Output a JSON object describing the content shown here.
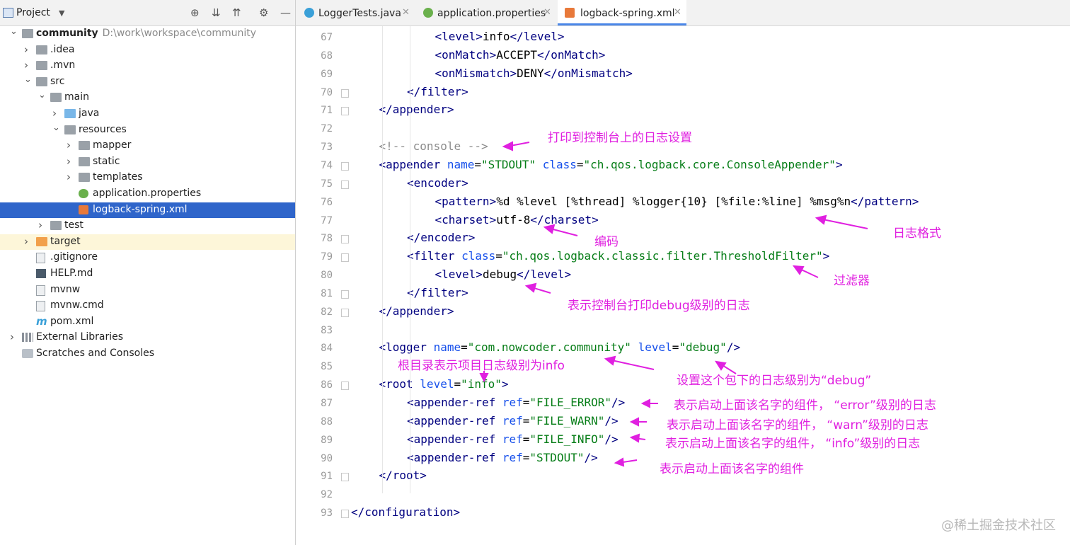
{
  "project_panel": {
    "title": "Project",
    "tree": [
      {
        "label": "community",
        "path": "D:\\work\\workspace\\community",
        "depth": 0,
        "expanded": true,
        "icon": "module-folder-icon",
        "bold": true
      },
      {
        "label": ".idea",
        "depth": 1,
        "expanded": false,
        "icon": "folder-icon"
      },
      {
        "label": ".mvn",
        "depth": 1,
        "expanded": false,
        "icon": "folder-icon"
      },
      {
        "label": "src",
        "depth": 1,
        "expanded": true,
        "icon": "folder-icon"
      },
      {
        "label": "main",
        "depth": 2,
        "expanded": true,
        "icon": "folder-icon"
      },
      {
        "label": "java",
        "depth": 3,
        "expanded": false,
        "icon": "source-folder-icon"
      },
      {
        "label": "resources",
        "depth": 3,
        "expanded": true,
        "icon": "resources-folder-icon"
      },
      {
        "label": "mapper",
        "depth": 4,
        "expanded": false,
        "icon": "folder-icon"
      },
      {
        "label": "static",
        "depth": 4,
        "expanded": false,
        "icon": "folder-icon"
      },
      {
        "label": "templates",
        "depth": 4,
        "expanded": false,
        "icon": "folder-icon"
      },
      {
        "label": "application.properties",
        "depth": 4,
        "icon": "properties-file-icon"
      },
      {
        "label": "logback-spring.xml",
        "depth": 4,
        "icon": "xml-file-icon",
        "selected": true
      },
      {
        "label": "test",
        "depth": 2,
        "expanded": false,
        "icon": "folder-icon"
      },
      {
        "label": "target",
        "depth": 1,
        "expanded": false,
        "icon": "excluded-folder-icon",
        "highlight": true
      },
      {
        "label": ".gitignore",
        "depth": 1,
        "icon": "text-file-icon"
      },
      {
        "label": "HELP.md",
        "depth": 1,
        "icon": "markdown-file-icon"
      },
      {
        "label": "mvnw",
        "depth": 1,
        "icon": "script-file-icon"
      },
      {
        "label": "mvnw.cmd",
        "depth": 1,
        "icon": "text-file-icon"
      },
      {
        "label": "pom.xml",
        "depth": 1,
        "icon": "maven-file-icon"
      },
      {
        "label": "External Libraries",
        "depth": 0,
        "expanded": false,
        "icon": "libraries-icon"
      },
      {
        "label": "Scratches and Consoles",
        "depth": 0,
        "icon": "scratches-icon"
      }
    ]
  },
  "tabs": [
    {
      "label": "LoggerTests.java",
      "icon": "java-class-icon",
      "active": false
    },
    {
      "label": "application.properties",
      "icon": "properties-file-icon",
      "active": false
    },
    {
      "label": "logback-spring.xml",
      "icon": "xml-file-icon",
      "active": true
    }
  ],
  "editor": {
    "lines": [
      {
        "n": "67",
        "indent": 3,
        "tokens": [
          [
            "tg",
            "<level>"
          ],
          [
            "tx",
            "info"
          ],
          [
            "tg",
            "</level>"
          ]
        ]
      },
      {
        "n": "68",
        "indent": 3,
        "tokens": [
          [
            "tg",
            "<onMatch>"
          ],
          [
            "tx",
            "ACCEPT"
          ],
          [
            "tg",
            "</onMatch>"
          ]
        ]
      },
      {
        "n": "69",
        "indent": 3,
        "tokens": [
          [
            "tg",
            "<onMismatch>"
          ],
          [
            "tx",
            "DENY"
          ],
          [
            "tg",
            "</onMismatch>"
          ]
        ]
      },
      {
        "n": "70",
        "indent": 2,
        "tokens": [
          [
            "tg",
            "</filter>"
          ]
        ],
        "fold": true
      },
      {
        "n": "71",
        "indent": 1,
        "tokens": [
          [
            "tg",
            "</appender>"
          ]
        ],
        "fold": true
      },
      {
        "n": "72",
        "indent": 0,
        "tokens": []
      },
      {
        "n": "73",
        "indent": 1,
        "tokens": [
          [
            "cm",
            "<!-- console -->"
          ]
        ]
      },
      {
        "n": "74",
        "indent": 1,
        "tokens": [
          [
            "tg",
            "<appender "
          ],
          [
            "an",
            "name"
          ],
          [
            "tx",
            "="
          ],
          [
            "av",
            "\"STDOUT\""
          ],
          [
            "tx",
            " "
          ],
          [
            "an",
            "class"
          ],
          [
            "tx",
            "="
          ],
          [
            "av",
            "\"ch.qos.logback.core.ConsoleAppender\""
          ],
          [
            "tg",
            ">"
          ]
        ],
        "fold": true
      },
      {
        "n": "75",
        "indent": 2,
        "tokens": [
          [
            "tg",
            "<encoder>"
          ]
        ],
        "fold": true
      },
      {
        "n": "76",
        "indent": 3,
        "tokens": [
          [
            "tg",
            "<pattern>"
          ],
          [
            "tx",
            "%d %level [%thread] %logger{10} [%file:%line] %msg%n"
          ],
          [
            "tg",
            "</pattern>"
          ]
        ]
      },
      {
        "n": "77",
        "indent": 3,
        "tokens": [
          [
            "tg",
            "<charset>"
          ],
          [
            "tx",
            "utf-8"
          ],
          [
            "tg",
            "</charset>"
          ]
        ]
      },
      {
        "n": "78",
        "indent": 2,
        "tokens": [
          [
            "tg",
            "</encoder>"
          ]
        ],
        "fold": true
      },
      {
        "n": "79",
        "indent": 2,
        "tokens": [
          [
            "tg",
            "<filter "
          ],
          [
            "an",
            "class"
          ],
          [
            "tx",
            "="
          ],
          [
            "av",
            "\"ch.qos.logback.classic.filter.ThresholdFilter\""
          ],
          [
            "tg",
            ">"
          ]
        ],
        "fold": true
      },
      {
        "n": "80",
        "indent": 3,
        "tokens": [
          [
            "tg",
            "<level>"
          ],
          [
            "tx",
            "debug"
          ],
          [
            "tg",
            "</level>"
          ]
        ]
      },
      {
        "n": "81",
        "indent": 2,
        "tokens": [
          [
            "tg",
            "</filter>"
          ]
        ],
        "fold": true
      },
      {
        "n": "82",
        "indent": 1,
        "tokens": [
          [
            "tg",
            "</appender>"
          ]
        ],
        "fold": true
      },
      {
        "n": "83",
        "indent": 0,
        "tokens": []
      },
      {
        "n": "84",
        "indent": 1,
        "tokens": [
          [
            "tg",
            "<logger "
          ],
          [
            "an",
            "name"
          ],
          [
            "tx",
            "="
          ],
          [
            "av",
            "\"com.nowcoder.community\""
          ],
          [
            "tx",
            " "
          ],
          [
            "an",
            "level"
          ],
          [
            "tx",
            "="
          ],
          [
            "av",
            "\"debug\""
          ],
          [
            "tg",
            "/>"
          ]
        ]
      },
      {
        "n": "85",
        "indent": 0,
        "tokens": []
      },
      {
        "n": "86",
        "indent": 1,
        "tokens": [
          [
            "tg",
            "<root "
          ],
          [
            "an",
            "level"
          ],
          [
            "tx",
            "="
          ],
          [
            "av",
            "\"info\""
          ],
          [
            "tg",
            ">"
          ]
        ],
        "fold": true
      },
      {
        "n": "87",
        "indent": 2,
        "tokens": [
          [
            "tg",
            "<appender-ref "
          ],
          [
            "an",
            "ref"
          ],
          [
            "tx",
            "="
          ],
          [
            "av",
            "\"FILE_ERROR\""
          ],
          [
            "tg",
            "/>"
          ]
        ]
      },
      {
        "n": "88",
        "indent": 2,
        "tokens": [
          [
            "tg",
            "<appender-ref "
          ],
          [
            "an",
            "ref"
          ],
          [
            "tx",
            "="
          ],
          [
            "av",
            "\"FILE_WARN\""
          ],
          [
            "tg",
            "/>"
          ]
        ]
      },
      {
        "n": "89",
        "indent": 2,
        "tokens": [
          [
            "tg",
            "<appender-ref "
          ],
          [
            "an",
            "ref"
          ],
          [
            "tx",
            "="
          ],
          [
            "av",
            "\"FILE_INFO\""
          ],
          [
            "tg",
            "/>"
          ]
        ]
      },
      {
        "n": "90",
        "indent": 2,
        "tokens": [
          [
            "tg",
            "<appender-ref "
          ],
          [
            "an",
            "ref"
          ],
          [
            "tx",
            "="
          ],
          [
            "av",
            "\"STDOUT\""
          ],
          [
            "tg",
            "/>"
          ]
        ]
      },
      {
        "n": "91",
        "indent": 1,
        "tokens": [
          [
            "tg",
            "</root>"
          ]
        ],
        "fold": true
      },
      {
        "n": "92",
        "indent": 0,
        "tokens": []
      },
      {
        "n": "93",
        "indent": 0,
        "tokens": [
          [
            "tg",
            "</configuration>"
          ]
        ],
        "fold": true
      }
    ]
  },
  "annotations": {
    "console_setting": "打印到控制台上的日志设置",
    "encoding": "编码",
    "log_format": "日志格式",
    "filter": "过滤器",
    "console_debug": "表示控制台打印debug级别的日志",
    "root_info": "根目录表示项目日志级别为info",
    "package_debug": "设置这个包下的日志级别为“debug”",
    "error_ref": "表示启动上面该名字的组件，  “error”级别的日志",
    "warn_ref": "表示启动上面该名字的组件，  “warn”级别的日志",
    "info_ref": "表示启动上面该名字的组件，  “info”级别的日志",
    "stdout_ref": "表示启动上面该名字的组件",
    "color": "#e020e0"
  },
  "watermark": "@稀土掘金技术社区"
}
